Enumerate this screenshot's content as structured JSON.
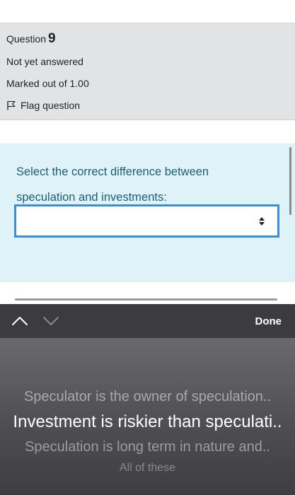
{
  "question": {
    "label": "Question",
    "number": "9",
    "status": "Not yet answered",
    "marks": "Marked out of 1.00",
    "flag_label": "Flag question",
    "text_line1": "Select the correct difference between",
    "text_line2": "speculation and investments:",
    "selected_value": ""
  },
  "picker": {
    "done_label": "Done",
    "options": [
      "Speculator is the owner of speculation..",
      "Investment is riskier than speculati..",
      "Speculation is long term in nature and..",
      "All of these"
    ],
    "selected_index": 1
  },
  "colors": {
    "question_bg": "#def2f8",
    "question_text": "#1e5e74",
    "info_bg": "#e2e3e5",
    "select_border": "#3a8fd6",
    "toolbar_bg": "#3c3c3e"
  },
  "icons": [
    "flag-icon",
    "select-arrows-icon",
    "chevron-up-icon",
    "chevron-down-icon"
  ]
}
